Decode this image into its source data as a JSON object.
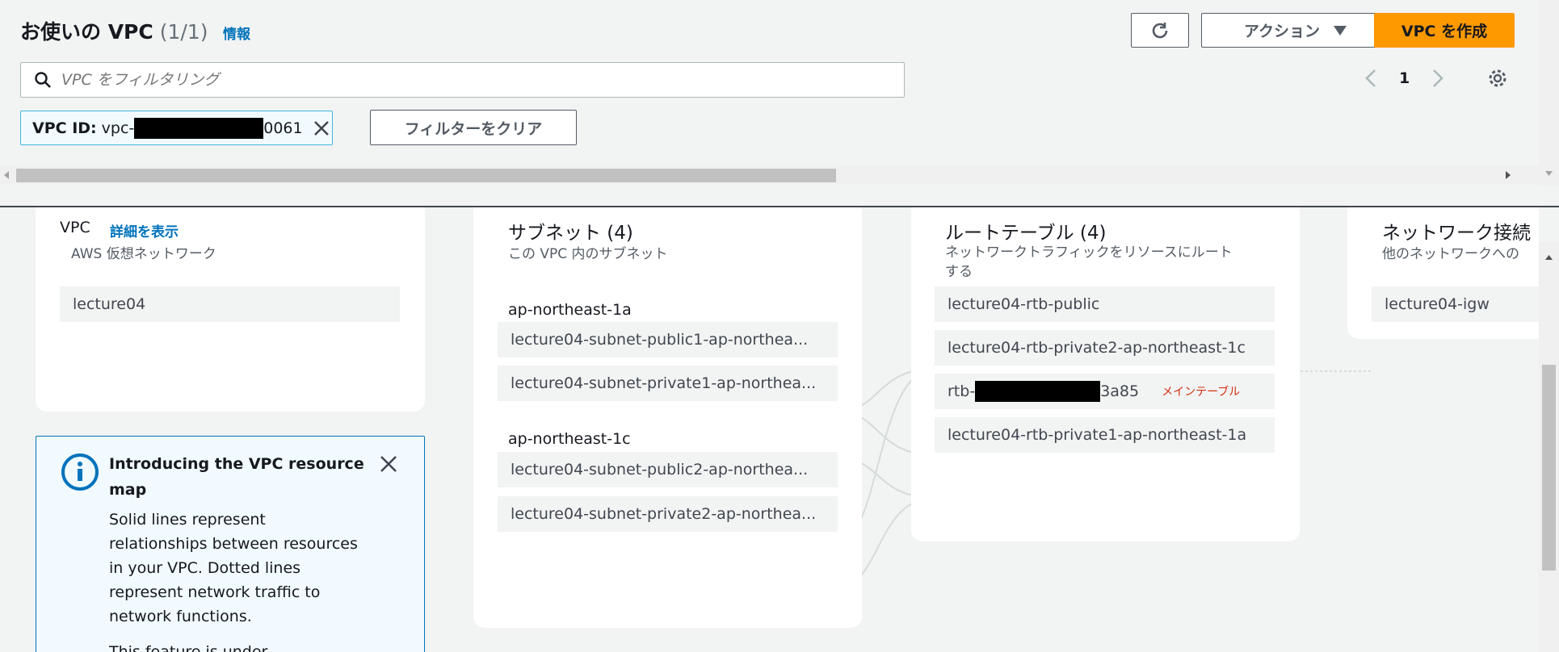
{
  "header": {
    "title": "お使いの VPC",
    "count": "(1/1)",
    "info_link": "情報",
    "refresh_icon": "refresh-icon",
    "actions_label": "アクション",
    "create_label": "VPC を作成"
  },
  "search": {
    "placeholder": "VPC をフィルタリング"
  },
  "pager": {
    "page": "1"
  },
  "filter_chip": {
    "label": "VPC ID:",
    "prefix": "vpc-",
    "suffix": "0061"
  },
  "clear_filter_label": "フィルターをクリア",
  "map": {
    "vpc": {
      "title": "VPC",
      "details_link": "詳細を表示",
      "subtitle": "AWS 仮想ネットワーク",
      "item": "lecture04"
    },
    "subnets": {
      "title": "サブネット (4)",
      "subtitle": "この VPC 内のサブネット",
      "az1": "ap-northeast-1a",
      "az2": "ap-northeast-1c",
      "items": [
        "lecture04-subnet-public1-ap-northea...",
        "lecture04-subnet-private1-ap-northea...",
        "lecture04-subnet-public2-ap-northea...",
        "lecture04-subnet-private2-ap-northea..."
      ]
    },
    "route_tables": {
      "title": "ルートテーブル (4)",
      "subtitle_line1": "ネットワークトラフィックをリソースにルート",
      "subtitle_line2": "する",
      "items": [
        "lecture04-rtb-public",
        "lecture04-rtb-private2-ap-northeast-1c",
        "lecture04-rtb-private1-ap-northeast-1a"
      ],
      "redacted_prefix": "rtb-",
      "redacted_suffix": "3a85",
      "main_badge": "メインテーブル"
    },
    "network": {
      "title": "ネットワーク接続",
      "subtitle": "他のネットワークへの",
      "item": "lecture04-igw"
    }
  },
  "intro": {
    "title_line1": "Introducing the VPC resource",
    "title_line2": "map",
    "body": [
      "Solid lines represent",
      "relationships between resources",
      "in your VPC. Dotted lines",
      "represent network traffic to",
      "network functions."
    ],
    "more": "This feature is under"
  },
  "colors": {
    "accent": "#ff9900",
    "link": "#0073bb",
    "badge": "#d13212"
  }
}
